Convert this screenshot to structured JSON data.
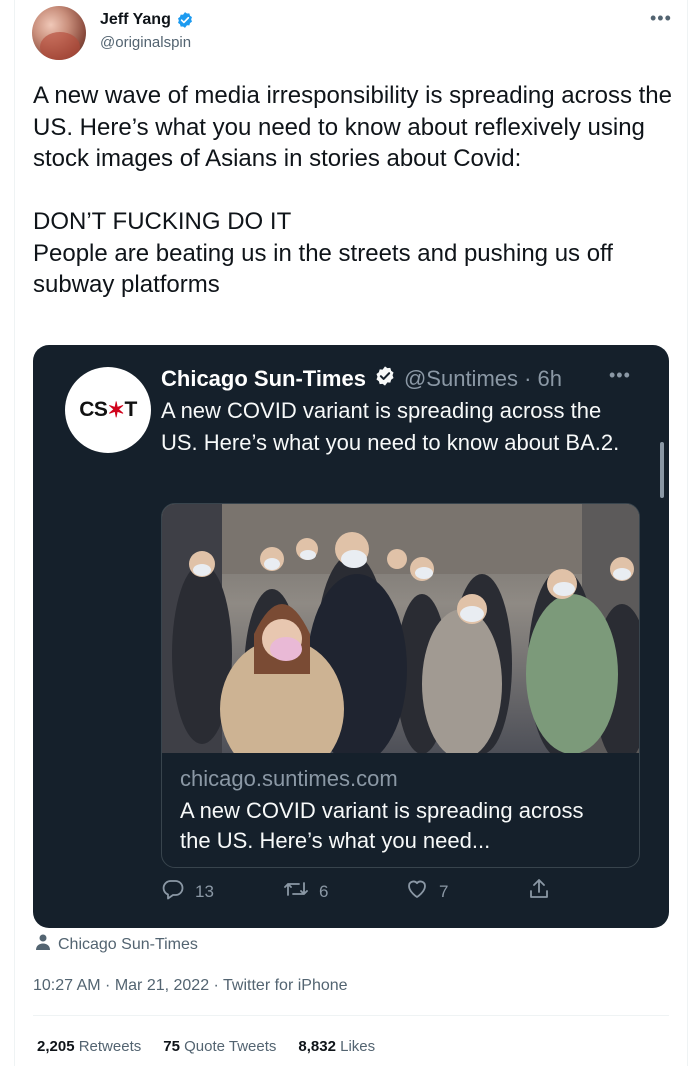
{
  "author": {
    "name": "Jeff Yang",
    "handle": "@originalspin"
  },
  "tweet": {
    "paragraph1": "A new wave of media irresponsibility is spreading across the US. Here’s what you need to know about reflexively using stock images of Asians in stories about Covid:",
    "line2": "DON’T FUCKING DO IT",
    "line3": "People are beating us in the streets and pushing us off subway platforms"
  },
  "quoted": {
    "logo_text_left": "CS",
    "logo_star": "✶",
    "logo_text_right": "T",
    "name": "Chicago Sun-Times",
    "handle_time": "@Suntimes · 6h",
    "text": "A new COVID variant is spreading across the US. Here’s what you need to know about BA.2.",
    "link_domain": "chicago.suntimes.com",
    "link_title": "A new COVID variant is spreading across the US. Here’s what you need...",
    "replies": "13",
    "retweets": "6",
    "likes": "7"
  },
  "via_label": "Chicago Sun-Times",
  "timestamp": "10:27 AM · Mar 21, 2022 · Twitter for iPhone",
  "stats": {
    "retweets_count": "2,205",
    "retweets_label": "Retweets",
    "quotes_count": "75",
    "quotes_label": "Quote Tweets",
    "likes_count": "8,832",
    "likes_label": "Likes"
  },
  "colors": {
    "verified": "#1d9bf0",
    "card_bg": "#15202b",
    "cst_star": "#d0021b"
  }
}
